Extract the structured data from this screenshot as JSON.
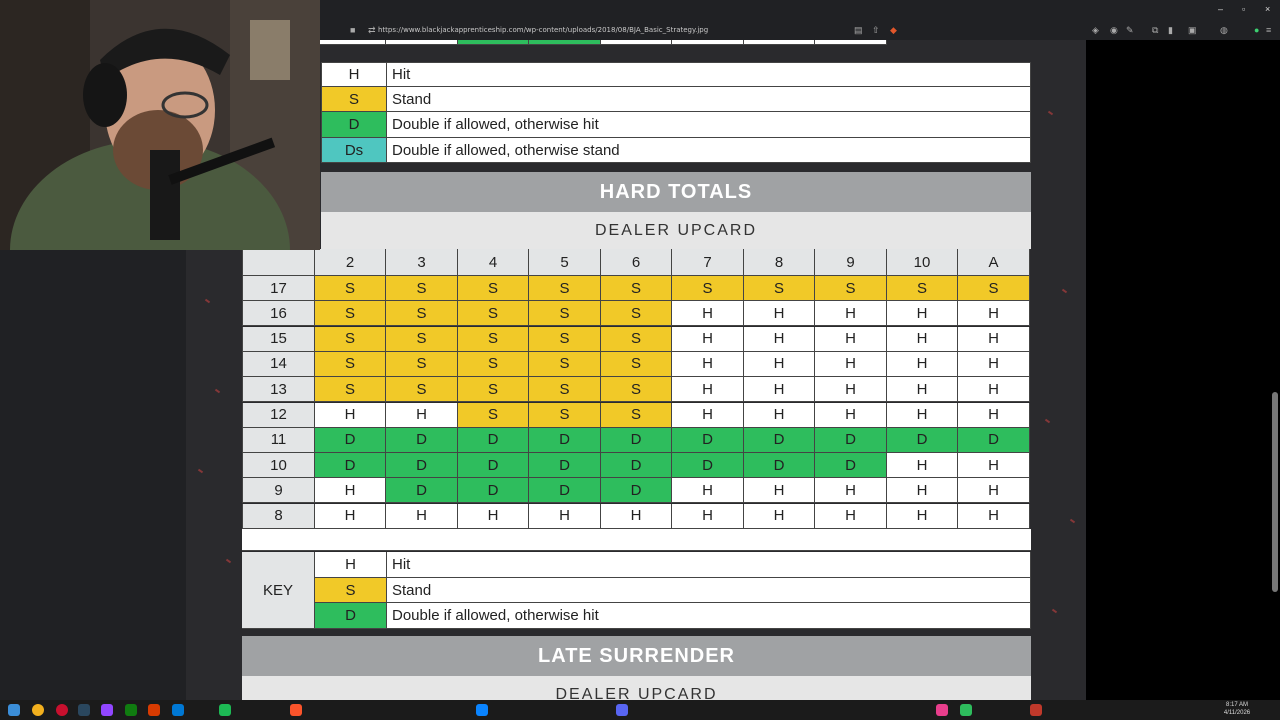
{
  "browser": {
    "url": "https://www.blackjackapprenticeship.com/wp-content/uploads/2018/08/BJA_Basic_Strategy.jpg",
    "window_controls": [
      "–",
      "▫",
      "×"
    ]
  },
  "top_key": [
    {
      "code": "H",
      "desc": "Hit",
      "color": "#ffffff"
    },
    {
      "code": "S",
      "desc": "Stand",
      "color": "#f1c928"
    },
    {
      "code": "D",
      "desc": "Double if allowed, otherwise hit",
      "color": "#2ebd5d"
    },
    {
      "code": "Ds",
      "desc": "Double if allowed, otherwise stand",
      "color": "#4fc6c0"
    }
  ],
  "hard_totals": {
    "title": "HARD TOTALS",
    "subtitle": "DEALER UPCARD",
    "upcards": [
      "2",
      "3",
      "4",
      "5",
      "6",
      "7",
      "8",
      "9",
      "10",
      "A"
    ],
    "rows": [
      {
        "total": "17",
        "cells": [
          "S",
          "S",
          "S",
          "S",
          "S",
          "S",
          "S",
          "S",
          "S",
          "S"
        ]
      },
      {
        "total": "16",
        "cells": [
          "S",
          "S",
          "S",
          "S",
          "S",
          "H",
          "H",
          "H",
          "H",
          "H"
        ]
      },
      {
        "total": "15",
        "cells": [
          "S",
          "S",
          "S",
          "S",
          "S",
          "H",
          "H",
          "H",
          "H",
          "H"
        ]
      },
      {
        "total": "14",
        "cells": [
          "S",
          "S",
          "S",
          "S",
          "S",
          "H",
          "H",
          "H",
          "H",
          "H"
        ]
      },
      {
        "total": "13",
        "cells": [
          "S",
          "S",
          "S",
          "S",
          "S",
          "H",
          "H",
          "H",
          "H",
          "H"
        ]
      },
      {
        "total": "12",
        "cells": [
          "H",
          "H",
          "S",
          "S",
          "S",
          "H",
          "H",
          "H",
          "H",
          "H"
        ]
      },
      {
        "total": "11",
        "cells": [
          "D",
          "D",
          "D",
          "D",
          "D",
          "D",
          "D",
          "D",
          "D",
          "D"
        ]
      },
      {
        "total": "10",
        "cells": [
          "D",
          "D",
          "D",
          "D",
          "D",
          "D",
          "D",
          "D",
          "H",
          "H"
        ]
      },
      {
        "total": "9",
        "cells": [
          "H",
          "D",
          "D",
          "D",
          "D",
          "H",
          "H",
          "H",
          "H",
          "H"
        ]
      },
      {
        "total": "8",
        "cells": [
          "H",
          "H",
          "H",
          "H",
          "H",
          "H",
          "H",
          "H",
          "H",
          "H"
        ]
      }
    ]
  },
  "bottom_key": {
    "label": "KEY",
    "items": [
      {
        "code": "H",
        "desc": "Hit"
      },
      {
        "code": "S",
        "desc": "Stand"
      },
      {
        "code": "D",
        "desc": "Double if allowed, otherwise hit"
      }
    ]
  },
  "late_surrender": {
    "title": "LATE SURRENDER",
    "subtitle": "DEALER UPCARD"
  },
  "colors": {
    "stand": "#f1c928",
    "double": "#2ebd5d",
    "double_stand": "#4fc6c0",
    "hit": "#ffffff"
  },
  "taskbar": {
    "time": "8:17 AM",
    "date": "4/11/2026"
  }
}
